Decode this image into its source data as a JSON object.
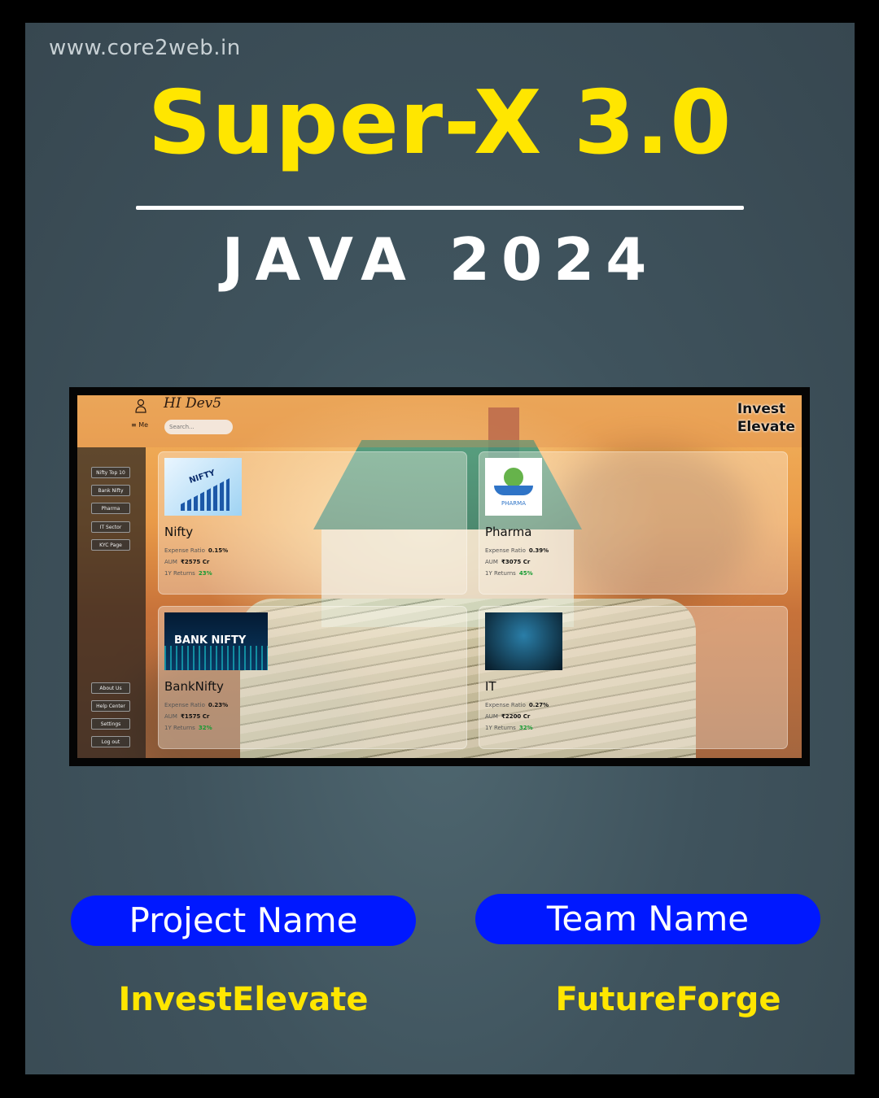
{
  "poster": {
    "site_url": "www.core2web.in",
    "title": "Super-X 3.0",
    "subtitle": "JAVA 2024",
    "colors": {
      "title": "#ffe600",
      "pill": "#0018ff",
      "background": "#3f535d"
    }
  },
  "screenshot": {
    "header": {
      "greeting": "HI Dev5",
      "menu_label": "≡ Me",
      "search_placeholder": "Search...",
      "brand_line1": "Invest",
      "brand_line2": "Elevate",
      "user_icon": "user-icon"
    },
    "sidebar": {
      "top_items": [
        "Nifty Top 10",
        "Bank Nifty",
        "Pharma",
        "IT Sector",
        "KYC Page"
      ],
      "bottom_items": [
        "About Us",
        "Help Center",
        "Settings",
        "Log out"
      ]
    },
    "cards": [
      {
        "title": "Nifty",
        "image_label": "NIFTY",
        "expense_label": "Expense Ratio",
        "expense": "0.15%",
        "aum_label": "AUM",
        "aum": "₹2575 Cr",
        "returns_label": "1Y Returns",
        "returns": "23%"
      },
      {
        "title": "Pharma",
        "image_label": "PHARMA",
        "expense_label": "Expense Ratio",
        "expense": "0.39%",
        "aum_label": "AUM",
        "aum": "₹3075 Cr",
        "returns_label": "1Y Returns",
        "returns": "45%"
      },
      {
        "title": "BankNifty",
        "image_label": "BANK NIFTY",
        "expense_label": "Expense Ratio",
        "expense": "0.23%",
        "aum_label": "AUM",
        "aum": "₹1575 Cr",
        "returns_label": "1Y Returns",
        "returns": "32%"
      },
      {
        "title": "IT",
        "image_label": "",
        "expense_label": "Expense Ratio",
        "expense": "0.27%",
        "aum_label": "AUM",
        "aum": "₹2200 Cr",
        "returns_label": "1Y Returns",
        "returns": "32%"
      }
    ]
  },
  "footer": {
    "project_label": "Project Name",
    "team_label": "Team Name",
    "project_name": "InvestElevate",
    "team_name": "FutureForge"
  }
}
